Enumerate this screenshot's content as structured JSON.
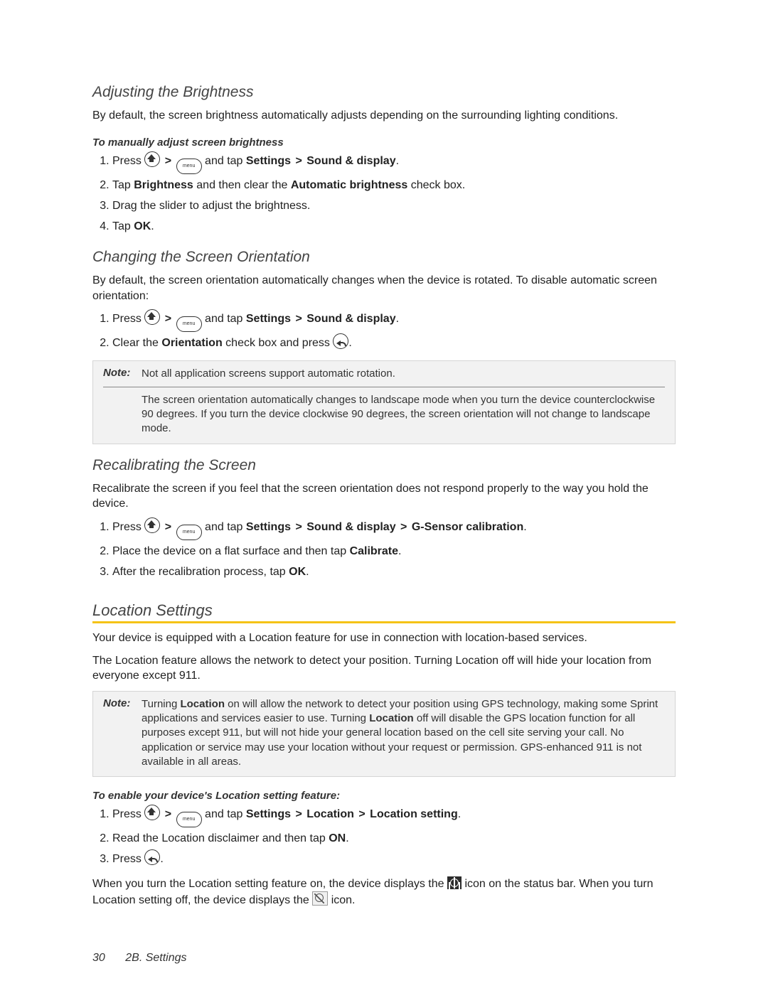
{
  "section1": {
    "title": "Adjusting the Brightness",
    "intro": "By default, the screen brightness automatically adjusts depending on the surrounding lighting conditions.",
    "subhead": "To manually adjust screen brightness",
    "steps": {
      "s1a": "Press ",
      "s1b": " and tap ",
      "s1c": "Settings",
      "s1d": "Sound & display",
      "s2a": "Tap ",
      "s2b": "Brightness",
      "s2c": " and then clear the ",
      "s2d": "Automatic brightness",
      "s2e": " check box.",
      "s3": "Drag the slider to adjust the brightness.",
      "s4a": "Tap ",
      "s4b": "OK",
      "s4c": "."
    }
  },
  "section2": {
    "title": "Changing the Screen Orientation",
    "intro": "By default, the screen orientation automatically changes when the device is rotated. To disable automatic screen orientation:",
    "steps": {
      "s1a": "Press ",
      "s1b": " and tap ",
      "s1c": "Settings",
      "s1d": "Sound & display",
      "s2a": "Clear the ",
      "s2b": "Orientation",
      "s2c": " check box and press "
    },
    "note1_label": "Note:",
    "note1_text": "Not all application screens support automatic rotation.",
    "note2_text": "The screen orientation automatically changes to landscape mode when you turn the device counterclockwise 90 degrees. If you turn the device clockwise 90 degrees, the screen orientation will not change to landscape mode."
  },
  "section3": {
    "title": "Recalibrating the Screen",
    "intro": "Recalibrate the screen if you feel that the screen orientation does not respond properly to the way you hold the device.",
    "steps": {
      "s1a": "Press ",
      "s1b": " and tap ",
      "s1c": "Settings",
      "s1d": "Sound & display",
      "s1e": "G-Sensor calibration",
      "s2a": "Place the device on a flat surface and then tap ",
      "s2b": "Calibrate",
      "s3a": "After the recalibration process, tap ",
      "s3b": "OK"
    }
  },
  "section4": {
    "title": "Location Settings",
    "intro1": "Your device is equipped with a Location feature for use in connection with location-based services.",
    "intro2": "The Location feature allows the network to detect your position. Turning Location off will hide your location from everyone except 911.",
    "note_label": "Note:",
    "note_text_a": "Turning ",
    "note_text_b": "Location",
    "note_text_c": " on will allow the network to detect your position using GPS technology, making some Sprint applications and services easier to use. Turning ",
    "note_text_d": "Location",
    "note_text_e": " off will disable the GPS location function for all purposes except 911, but will not hide your general location based on the cell site serving your call. No application or service may use your location without your request or permission. GPS-enhanced 911 is not available in all areas.",
    "subhead": "To enable your device's Location setting feature:",
    "steps": {
      "s1a": "Press ",
      "s1b": " and tap ",
      "s1c": "Settings",
      "s1d": "Location",
      "s1e": "Location setting",
      "s2a": "Read the Location disclaimer and then tap ",
      "s2b": "ON",
      "s3a": "Press "
    },
    "tail_a": "When you turn the Location setting feature on, the device displays the ",
    "tail_b": " icon on the status bar. When you turn Location setting off, the device displays the ",
    "tail_c": " icon."
  },
  "symbols": {
    "gt": " > ",
    "period": "."
  },
  "icons": {
    "menu_label": "menu"
  },
  "footer": {
    "page_no": "30",
    "chapter": "2B. Settings"
  }
}
